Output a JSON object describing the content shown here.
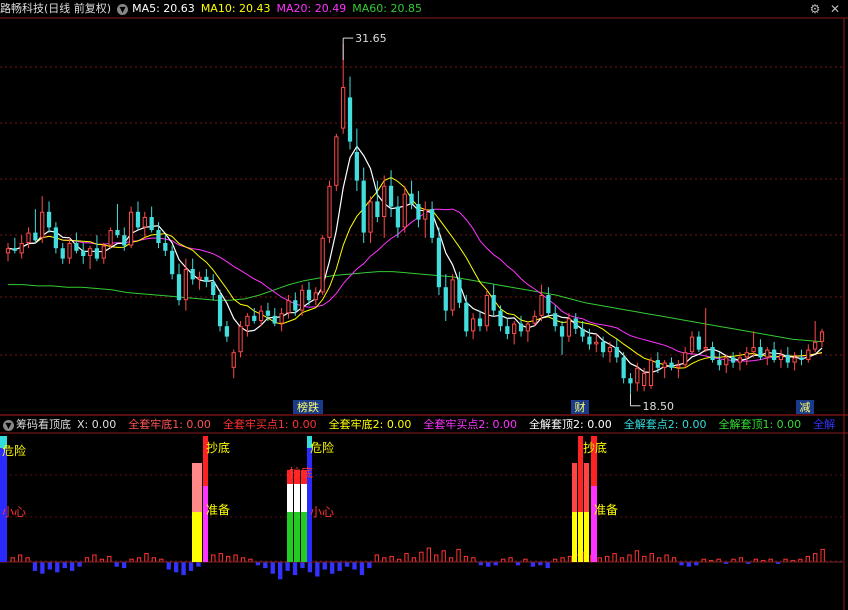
{
  "main_header": {
    "title": "路畅科技(日线 前复权)",
    "ma5": "MA5: 20.63",
    "ma10": "MA10: 20.43",
    "ma20": "MA20: 20.49",
    "ma60": "MA60: 20.85",
    "colors": {
      "ma5": "#ffffff",
      "ma10": "#ffff00",
      "ma20": "#ff33ff",
      "ma60": "#33cc33"
    }
  },
  "window_controls": {
    "settings_icon": "gear-icon",
    "close_icon": "close-icon"
  },
  "price_labels": {
    "high": "31.65",
    "low": "18.50"
  },
  "event_tags": [
    "榜跌",
    "财",
    "减"
  ],
  "indicator_header": {
    "name": "筹码看顶底",
    "x": "X: 0.00",
    "items": [
      {
        "text": "全套牢底1: 0.00",
        "color": "#ff5555"
      },
      {
        "text": "全套牢买点1: 0.00",
        "color": "#ff3333"
      },
      {
        "text": "全套牢底2: 0.00",
        "color": "#ffff00"
      },
      {
        "text": "全套牢买点2: 0.00",
        "color": "#ff33ff"
      },
      {
        "text": "全解套顶2: 0.00",
        "color": "#ffffff"
      },
      {
        "text": "全解套点2: 0.00",
        "color": "#33dddd"
      },
      {
        "text": "全解套顶1: 0.00",
        "color": "#33dd33"
      },
      {
        "text": "全解",
        "color": "#3333ff"
      }
    ]
  },
  "indicator_labels": [
    "危险",
    "小心",
    "抄底",
    "准备",
    "危险",
    "抄底",
    "小心",
    "抄底",
    "准备"
  ],
  "chart_data": {
    "type": "candlestick",
    "price_range": [
      17.5,
      32.5
    ],
    "candles": [
      {
        "o": 23.6,
        "h": 24.0,
        "l": 23.3,
        "c": 23.8
      },
      {
        "o": 23.8,
        "h": 24.2,
        "l": 23.6,
        "c": 23.7
      },
      {
        "o": 23.6,
        "h": 24.3,
        "l": 23.4,
        "c": 24.0
      },
      {
        "o": 24.0,
        "h": 24.6,
        "l": 23.8,
        "c": 24.4
      },
      {
        "o": 24.4,
        "h": 25.3,
        "l": 24.0,
        "c": 24.1
      },
      {
        "o": 24.2,
        "h": 25.8,
        "l": 24.0,
        "c": 25.2
      },
      {
        "o": 25.2,
        "h": 25.6,
        "l": 24.4,
        "c": 24.6
      },
      {
        "o": 24.6,
        "h": 24.8,
        "l": 23.6,
        "c": 23.8
      },
      {
        "o": 23.8,
        "h": 24.0,
        "l": 23.2,
        "c": 23.4
      },
      {
        "o": 23.4,
        "h": 24.2,
        "l": 23.2,
        "c": 24.0
      },
      {
        "o": 24.0,
        "h": 24.4,
        "l": 23.6,
        "c": 23.7
      },
      {
        "o": 23.7,
        "h": 24.0,
        "l": 23.2,
        "c": 23.5
      },
      {
        "o": 23.5,
        "h": 23.9,
        "l": 23.0,
        "c": 23.8
      },
      {
        "o": 23.8,
        "h": 24.3,
        "l": 23.3,
        "c": 23.4
      },
      {
        "o": 23.4,
        "h": 24.0,
        "l": 23.2,
        "c": 23.9
      },
      {
        "o": 23.9,
        "h": 24.6,
        "l": 23.8,
        "c": 24.5
      },
      {
        "o": 24.5,
        "h": 25.5,
        "l": 24.2,
        "c": 24.3
      },
      {
        "o": 24.3,
        "h": 24.6,
        "l": 23.7,
        "c": 23.9
      },
      {
        "o": 23.9,
        "h": 25.4,
        "l": 23.8,
        "c": 25.2
      },
      {
        "o": 25.2,
        "h": 25.6,
        "l": 24.5,
        "c": 24.6
      },
      {
        "o": 24.6,
        "h": 25.2,
        "l": 24.2,
        "c": 25.0
      },
      {
        "o": 25.0,
        "h": 25.4,
        "l": 24.4,
        "c": 24.5
      },
      {
        "o": 24.5,
        "h": 24.8,
        "l": 23.8,
        "c": 24.0
      },
      {
        "o": 24.0,
        "h": 24.3,
        "l": 23.5,
        "c": 23.7
      },
      {
        "o": 23.7,
        "h": 23.9,
        "l": 22.6,
        "c": 22.8
      },
      {
        "o": 22.8,
        "h": 23.2,
        "l": 21.6,
        "c": 21.8
      },
      {
        "o": 21.8,
        "h": 23.4,
        "l": 21.4,
        "c": 23.0
      },
      {
        "o": 23.0,
        "h": 23.4,
        "l": 22.4,
        "c": 22.6
      },
      {
        "o": 22.6,
        "h": 22.9,
        "l": 22.2,
        "c": 22.7
      },
      {
        "o": 22.7,
        "h": 23.0,
        "l": 22.3,
        "c": 22.5
      },
      {
        "o": 22.5,
        "h": 22.8,
        "l": 21.8,
        "c": 22.0
      },
      {
        "o": 22.0,
        "h": 22.2,
        "l": 20.6,
        "c": 20.8
      },
      {
        "o": 20.8,
        "h": 21.0,
        "l": 20.2,
        "c": 20.4
      },
      {
        "o": 19.2,
        "h": 19.9,
        "l": 18.8,
        "c": 19.8
      },
      {
        "o": 19.8,
        "h": 21.0,
        "l": 19.6,
        "c": 20.8
      },
      {
        "o": 20.8,
        "h": 21.3,
        "l": 20.4,
        "c": 21.2
      },
      {
        "o": 21.2,
        "h": 21.5,
        "l": 20.9,
        "c": 21.0
      },
      {
        "o": 21.0,
        "h": 21.6,
        "l": 20.8,
        "c": 21.4
      },
      {
        "o": 21.4,
        "h": 21.7,
        "l": 21.0,
        "c": 21.2
      },
      {
        "o": 21.2,
        "h": 21.5,
        "l": 20.8,
        "c": 20.9
      },
      {
        "o": 20.9,
        "h": 21.5,
        "l": 20.6,
        "c": 21.3
      },
      {
        "o": 21.3,
        "h": 22.0,
        "l": 21.1,
        "c": 21.8
      },
      {
        "o": 21.8,
        "h": 22.1,
        "l": 21.2,
        "c": 21.4
      },
      {
        "o": 21.4,
        "h": 22.4,
        "l": 21.2,
        "c": 22.2
      },
      {
        "o": 22.2,
        "h": 22.5,
        "l": 21.6,
        "c": 21.8
      },
      {
        "o": 21.8,
        "h": 22.3,
        "l": 21.6,
        "c": 22.1
      },
      {
        "o": 22.1,
        "h": 24.3,
        "l": 22.0,
        "c": 24.2
      },
      {
        "o": 24.2,
        "h": 26.4,
        "l": 24.0,
        "c": 26.2
      },
      {
        "o": 26.2,
        "h": 28.2,
        "l": 26.0,
        "c": 28.1
      },
      {
        "o": 28.4,
        "h": 31.65,
        "l": 28.2,
        "c": 30.0
      },
      {
        "o": 29.6,
        "h": 30.4,
        "l": 27.6,
        "c": 27.9
      },
      {
        "o": 27.5,
        "h": 28.4,
        "l": 26.0,
        "c": 26.4
      },
      {
        "o": 26.4,
        "h": 26.9,
        "l": 24.0,
        "c": 24.4
      },
      {
        "o": 24.4,
        "h": 25.8,
        "l": 24.0,
        "c": 25.6
      },
      {
        "o": 25.6,
        "h": 26.4,
        "l": 24.8,
        "c": 25.0
      },
      {
        "o": 25.0,
        "h": 26.6,
        "l": 24.2,
        "c": 26.2
      },
      {
        "o": 26.2,
        "h": 26.8,
        "l": 25.0,
        "c": 25.4
      },
      {
        "o": 25.4,
        "h": 25.8,
        "l": 24.2,
        "c": 24.6
      },
      {
        "o": 24.6,
        "h": 26.2,
        "l": 24.4,
        "c": 25.9
      },
      {
        "o": 25.9,
        "h": 26.4,
        "l": 25.3,
        "c": 25.5
      },
      {
        "o": 25.5,
        "h": 26.0,
        "l": 24.6,
        "c": 24.9
      },
      {
        "o": 24.9,
        "h": 25.6,
        "l": 24.2,
        "c": 25.3
      },
      {
        "o": 25.3,
        "h": 25.6,
        "l": 24.0,
        "c": 24.2
      },
      {
        "o": 24.2,
        "h": 24.6,
        "l": 22.0,
        "c": 22.3
      },
      {
        "o": 22.3,
        "h": 22.8,
        "l": 21.0,
        "c": 21.4
      },
      {
        "o": 21.4,
        "h": 22.8,
        "l": 21.2,
        "c": 22.6
      },
      {
        "o": 22.6,
        "h": 22.9,
        "l": 21.5,
        "c": 21.7
      },
      {
        "o": 21.7,
        "h": 22.0,
        "l": 20.4,
        "c": 20.6
      },
      {
        "o": 20.6,
        "h": 21.3,
        "l": 20.3,
        "c": 21.1
      },
      {
        "o": 21.1,
        "h": 21.4,
        "l": 20.6,
        "c": 20.8
      },
      {
        "o": 20.8,
        "h": 22.2,
        "l": 20.6,
        "c": 22.0
      },
      {
        "o": 22.0,
        "h": 22.4,
        "l": 21.2,
        "c": 21.4
      },
      {
        "o": 21.4,
        "h": 21.6,
        "l": 20.6,
        "c": 20.8
      },
      {
        "o": 20.8,
        "h": 21.1,
        "l": 20.3,
        "c": 20.5
      },
      {
        "o": 20.5,
        "h": 21.0,
        "l": 20.1,
        "c": 20.9
      },
      {
        "o": 20.9,
        "h": 21.2,
        "l": 20.4,
        "c": 20.6
      },
      {
        "o": 20.6,
        "h": 21.0,
        "l": 20.2,
        "c": 20.9
      },
      {
        "o": 20.9,
        "h": 21.4,
        "l": 20.8,
        "c": 21.2
      },
      {
        "o": 21.2,
        "h": 22.4,
        "l": 21.0,
        "c": 22.0
      },
      {
        "o": 22.0,
        "h": 22.3,
        "l": 21.2,
        "c": 21.3
      },
      {
        "o": 21.3,
        "h": 21.6,
        "l": 20.6,
        "c": 20.8
      },
      {
        "o": 20.8,
        "h": 21.0,
        "l": 19.7,
        "c": 20.4
      },
      {
        "o": 20.4,
        "h": 21.3,
        "l": 20.2,
        "c": 21.1
      },
      {
        "o": 21.1,
        "h": 21.3,
        "l": 20.5,
        "c": 20.7
      },
      {
        "o": 20.7,
        "h": 21.0,
        "l": 20.2,
        "c": 20.4
      },
      {
        "o": 20.4,
        "h": 20.7,
        "l": 19.9,
        "c": 20.1
      },
      {
        "o": 20.1,
        "h": 20.5,
        "l": 19.8,
        "c": 20.2
      },
      {
        "o": 20.2,
        "h": 20.4,
        "l": 19.6,
        "c": 19.8
      },
      {
        "o": 19.8,
        "h": 20.2,
        "l": 19.4,
        "c": 20.0
      },
      {
        "o": 20.0,
        "h": 20.3,
        "l": 19.4,
        "c": 19.6
      },
      {
        "o": 19.6,
        "h": 19.8,
        "l": 18.6,
        "c": 18.8
      },
      {
        "o": 18.8,
        "h": 19.0,
        "l": 18.2,
        "c": 18.6
      },
      {
        "o": 18.6,
        "h": 19.4,
        "l": 18.3,
        "c": 19.2
      },
      {
        "o": 18.5,
        "h": 19.2,
        "l": 18.3,
        "c": 19.0
      },
      {
        "o": 18.5,
        "h": 19.6,
        "l": 18.4,
        "c": 19.5
      },
      {
        "o": 19.5,
        "h": 19.8,
        "l": 19.0,
        "c": 19.2
      },
      {
        "o": 19.2,
        "h": 19.5,
        "l": 18.8,
        "c": 19.4
      },
      {
        "o": 19.4,
        "h": 19.6,
        "l": 19.1,
        "c": 19.2
      },
      {
        "o": 19.2,
        "h": 19.5,
        "l": 18.8,
        "c": 19.3
      },
      {
        "o": 19.3,
        "h": 20.0,
        "l": 19.2,
        "c": 19.8
      },
      {
        "o": 19.8,
        "h": 20.6,
        "l": 19.7,
        "c": 20.4
      },
      {
        "o": 20.4,
        "h": 20.6,
        "l": 19.8,
        "c": 19.9
      },
      {
        "o": 19.9,
        "h": 21.5,
        "l": 19.8,
        "c": 20.0
      },
      {
        "o": 20.0,
        "h": 20.2,
        "l": 19.4,
        "c": 19.5
      },
      {
        "o": 19.5,
        "h": 19.8,
        "l": 19.1,
        "c": 19.3
      },
      {
        "o": 19.3,
        "h": 19.7,
        "l": 19.0,
        "c": 19.6
      },
      {
        "o": 19.6,
        "h": 19.8,
        "l": 19.2,
        "c": 19.4
      },
      {
        "o": 19.4,
        "h": 19.8,
        "l": 19.1,
        "c": 19.6
      },
      {
        "o": 19.6,
        "h": 20.0,
        "l": 19.3,
        "c": 19.8
      },
      {
        "o": 19.8,
        "h": 20.6,
        "l": 19.6,
        "c": 20.0
      },
      {
        "o": 20.0,
        "h": 20.3,
        "l": 19.5,
        "c": 19.6
      },
      {
        "o": 19.6,
        "h": 20.0,
        "l": 19.3,
        "c": 19.9
      },
      {
        "o": 19.9,
        "h": 20.2,
        "l": 19.4,
        "c": 19.5
      },
      {
        "o": 19.5,
        "h": 19.9,
        "l": 19.2,
        "c": 19.7
      },
      {
        "o": 19.7,
        "h": 20.0,
        "l": 19.2,
        "c": 19.4
      },
      {
        "o": 19.4,
        "h": 19.8,
        "l": 19.1,
        "c": 19.6
      },
      {
        "o": 19.6,
        "h": 19.9,
        "l": 19.3,
        "c": 19.5
      },
      {
        "o": 19.5,
        "h": 20.1,
        "l": 19.4,
        "c": 19.9
      },
      {
        "o": 19.9,
        "h": 21.0,
        "l": 19.8,
        "c": 20.2
      },
      {
        "o": 20.2,
        "h": 20.7,
        "l": 20.0,
        "c": 20.6
      }
    ],
    "ma60": [
      22.4,
      22.4,
      22.35,
      22.35,
      22.3,
      22.3,
      22.25,
      22.2,
      22.1,
      22.05,
      22.0,
      21.95,
      21.9,
      21.85,
      21.8,
      21.8,
      21.85,
      22.0,
      22.2,
      22.4,
      22.55,
      22.65,
      22.75,
      22.8,
      22.85,
      22.9,
      22.9,
      22.85,
      22.8,
      22.75,
      22.7,
      22.6,
      22.5,
      22.4,
      22.3,
      22.2,
      22.1,
      22.0,
      21.85,
      21.7,
      21.6,
      21.5,
      21.4,
      21.3,
      21.2,
      21.1,
      21.0,
      20.9,
      20.8,
      20.7,
      20.6,
      20.5,
      20.4,
      20.3,
      20.25,
      20.2
    ],
    "indicator_bars": [
      0.3,
      0.5,
      0.3,
      -0.6,
      -0.8,
      -0.5,
      -0.7,
      -0.4,
      -0.6,
      -0.3,
      0.3,
      0.5,
      0.2,
      0.4,
      -0.3,
      -0.4,
      0.2,
      0.3,
      0.6,
      0.3,
      0.2,
      -0.5,
      -0.7,
      -0.9,
      -0.6,
      -0.3,
      0.4,
      0.5,
      0.6,
      0.4,
      0.5,
      0.3,
      0.2,
      -0.2,
      -0.4,
      -0.8,
      -1.2,
      -0.6,
      -0.9,
      -0.4,
      -0.7,
      -1.0,
      -0.5,
      -0.8,
      -0.6,
      -0.3,
      -0.5,
      -0.9,
      -0.4,
      0.5,
      0.3,
      0.4,
      0.2,
      0.6,
      0.3,
      0.7,
      1.0,
      0.5,
      0.8,
      0.3,
      0.9,
      0.4,
      0.3,
      -0.2,
      -0.3,
      -0.2,
      0.2,
      0.3,
      -0.2,
      0.2,
      -0.3,
      -0.2,
      -0.4,
      0.2,
      0.3,
      0.4,
      0.5,
      0.7,
      0.5,
      0.3,
      0.4,
      0.6,
      0.3,
      0.5,
      0.8,
      0.4,
      0.6,
      0.3,
      0.5,
      0.3,
      -0.2,
      -0.3,
      -0.2,
      0.2,
      0.1,
      0.2,
      -0.1,
      0.2,
      0.3,
      -0.1,
      0.2,
      0.1,
      0.2,
      -0.1,
      0.2,
      0.1,
      0.2,
      0.4,
      0.6,
      0.9
    ]
  }
}
